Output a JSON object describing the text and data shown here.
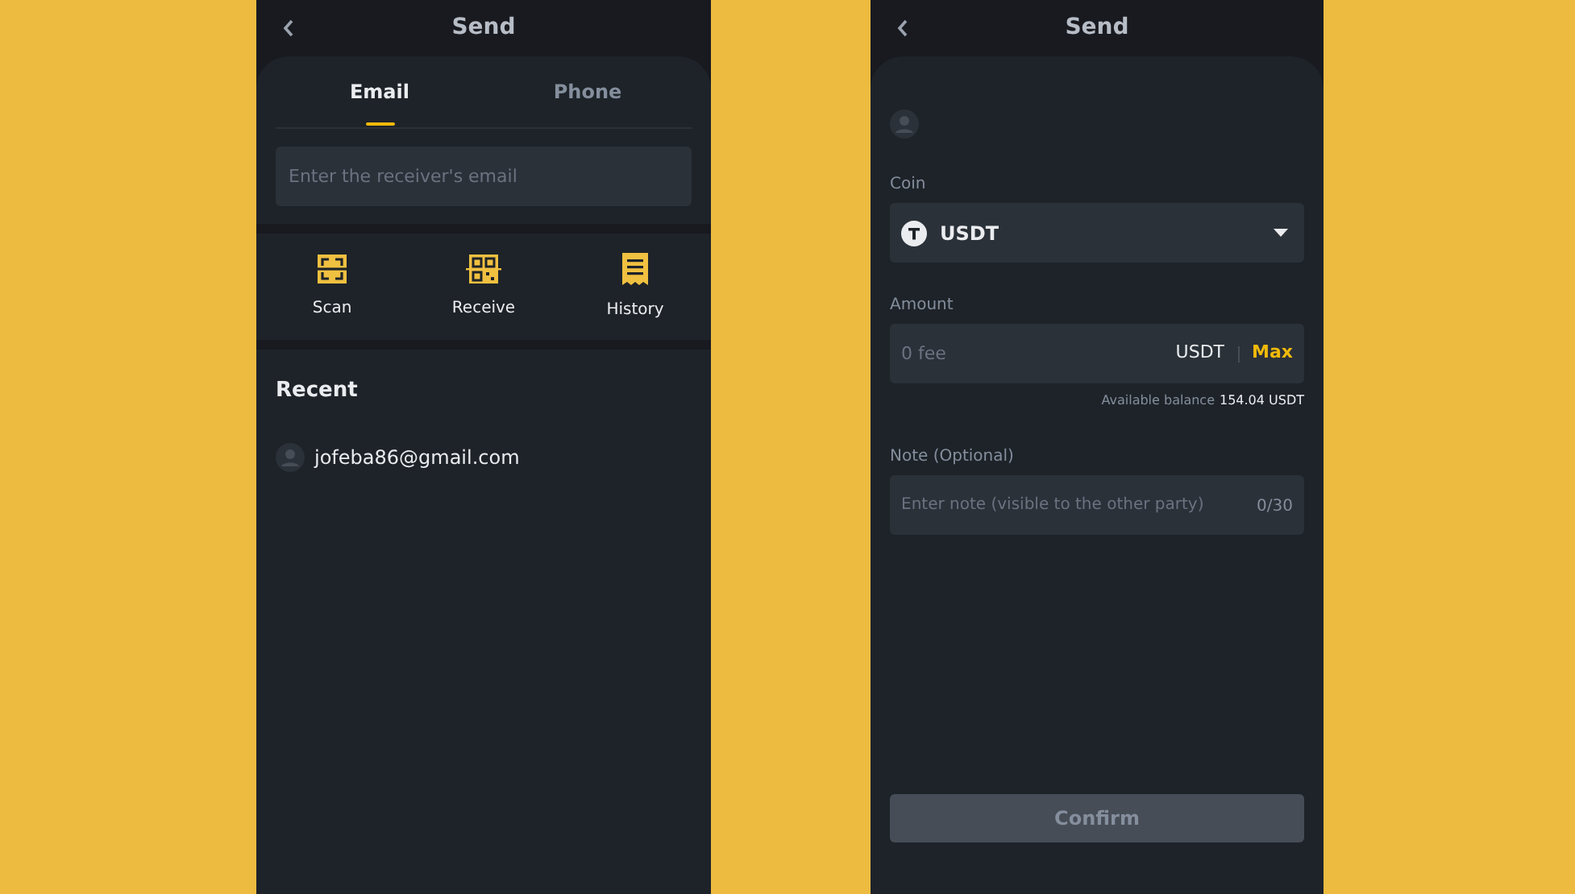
{
  "left_screen": {
    "title": "Send",
    "tabs": [
      {
        "label": "Email",
        "selected": true
      },
      {
        "label": "Phone",
        "selected": false
      }
    ],
    "receiver_field": {
      "placeholder": "Enter the receiver's email"
    },
    "actions": [
      {
        "label": "Scan",
        "kind": "scan"
      },
      {
        "label": "Receive",
        "kind": "qr"
      },
      {
        "label": "History",
        "kind": "receipt"
      }
    ],
    "recent": {
      "title": "Recent",
      "contacts": [
        "jofeba86@gmail.com"
      ]
    }
  },
  "right_screen": {
    "title": "Send",
    "coin": {
      "label": "Coin",
      "value": "USDT"
    },
    "amount": {
      "label": "Amount",
      "placeholder": "0 fee",
      "unit": "USDT",
      "max": "Max",
      "balance_label": "Available balance",
      "balance": "154.04 USDT"
    },
    "note": {
      "label": "Note (Optional)",
      "placeholder": "Enter note (visible to the other party)",
      "counter": "0/30"
    },
    "confirm": {
      "label": "Confirm",
      "disabled": true
    }
  }
}
